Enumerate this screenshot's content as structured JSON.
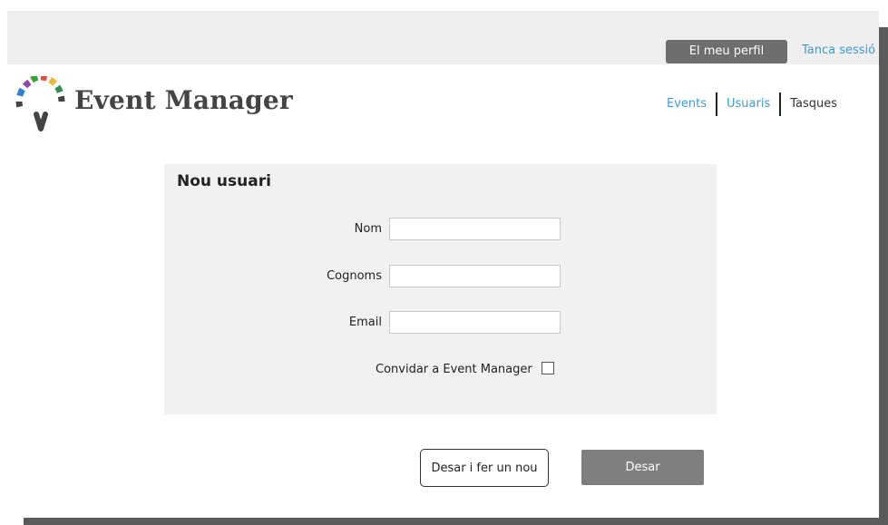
{
  "topbar": {
    "profile_label": "El meu perfil",
    "logout_label": "Tanca sessió"
  },
  "header": {
    "brand": "Event Manager",
    "logo_icon": "speech-bubble-ring-logo",
    "nav": [
      {
        "label": "Events"
      },
      {
        "label": "Usuaris"
      },
      {
        "label": "Tasques"
      }
    ]
  },
  "form": {
    "title": "Nou usuari",
    "fields": [
      {
        "label": "Nom",
        "value": ""
      },
      {
        "label": "Cognoms",
        "value": ""
      },
      {
        "label": "Email",
        "value": ""
      }
    ],
    "invite_label": "Convidar a Event Manager",
    "invite_checked": false
  },
  "actions": {
    "save_and_new_label": "Desar i fer un nou",
    "save_label": "Desar"
  },
  "colors": {
    "link": "#3a9bd5",
    "topbar_bg": "#efefef",
    "card_bg": "#f1f1f1",
    "button_dark": "#7f7f7f"
  }
}
